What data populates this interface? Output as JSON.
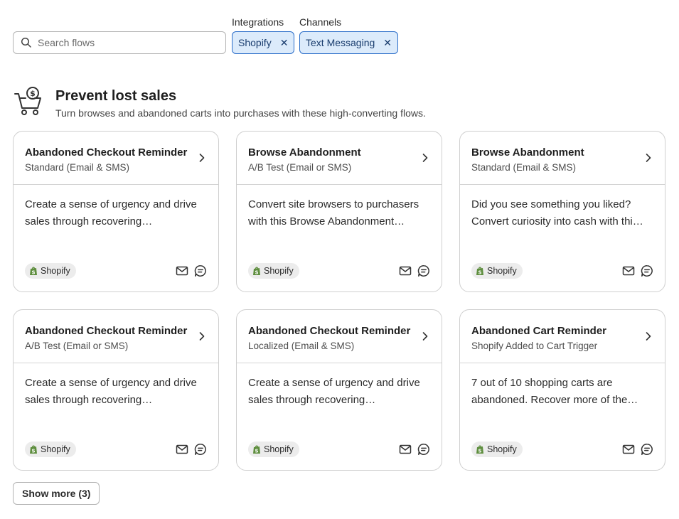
{
  "filters": {
    "search_placeholder": "Search flows",
    "integrations": {
      "label": "Integrations",
      "chip": "Shopify"
    },
    "channels": {
      "label": "Channels",
      "chip": "Text Messaging"
    },
    "chip_remove_glyph": "✕"
  },
  "section": {
    "title": "Prevent lost sales",
    "subtitle": "Turn browses and abandoned carts into purchases with these high-converting flows."
  },
  "cards": [
    {
      "title": "Abandoned Checkout Reminder",
      "subtitle": "Standard (Email & SMS)",
      "description": "Create a sense of urgency and drive sales through recovering…",
      "integration": "Shopify"
    },
    {
      "title": "Browse Abandonment",
      "subtitle": "A/B Test (Email or SMS)",
      "description": "Convert site browsers to purchasers with this Browse Abandonment…",
      "integration": "Shopify"
    },
    {
      "title": "Browse Abandonment",
      "subtitle": "Standard (Email & SMS)",
      "description": "Did you see something you liked? Convert curiosity into cash with thi…",
      "integration": "Shopify"
    },
    {
      "title": "Abandoned Checkout Reminder",
      "subtitle": "A/B Test (Email or SMS)",
      "description": "Create a sense of urgency and drive sales through recovering…",
      "integration": "Shopify"
    },
    {
      "title": "Abandoned Checkout Reminder",
      "subtitle": "Localized (Email & SMS)",
      "description": "Create a sense of urgency and drive sales through recovering…",
      "integration": "Shopify"
    },
    {
      "title": "Abandoned Cart Reminder",
      "subtitle": "Shopify Added to Cart Trigger",
      "description": "7 out of 10 shopping carts are abandoned. Recover more of the…",
      "integration": "Shopify"
    }
  ],
  "show_more_label": "Show more (3)",
  "colors": {
    "chip_bg": "#dcebfb",
    "chip_border": "#2a6dc9",
    "shopify_green": "#5e8e3e"
  },
  "icons": [
    "search-icon",
    "cart-dollar-icon",
    "chevron-right-icon",
    "shopify-icon",
    "email-icon",
    "sms-icon",
    "close-icon"
  ]
}
